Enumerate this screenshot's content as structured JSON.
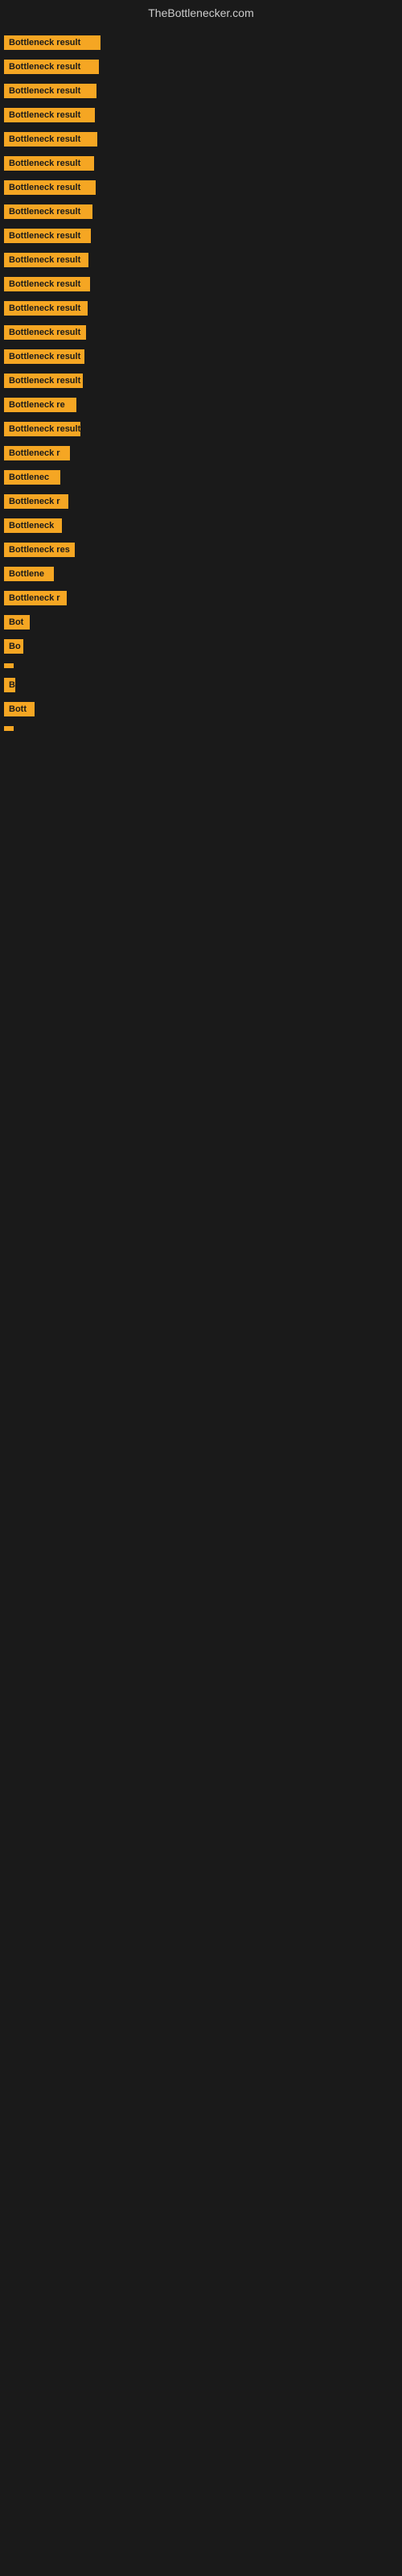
{
  "header": {
    "title": "TheBottlenecker.com"
  },
  "bars": [
    {
      "label": "Bottleneck result",
      "width": 120,
      "marginLeft": 5
    },
    {
      "label": "Bottleneck result",
      "width": 118,
      "marginLeft": 5
    },
    {
      "label": "Bottleneck result",
      "width": 115,
      "marginLeft": 5
    },
    {
      "label": "Bottleneck result",
      "width": 113,
      "marginLeft": 5
    },
    {
      "label": "Bottleneck result",
      "width": 116,
      "marginLeft": 5
    },
    {
      "label": "Bottleneck result",
      "width": 112,
      "marginLeft": 5
    },
    {
      "label": "Bottleneck result",
      "width": 114,
      "marginLeft": 5
    },
    {
      "label": "Bottleneck result",
      "width": 110,
      "marginLeft": 5
    },
    {
      "label": "Bottleneck result",
      "width": 108,
      "marginLeft": 5
    },
    {
      "label": "Bottleneck result",
      "width": 105,
      "marginLeft": 5
    },
    {
      "label": "Bottleneck result",
      "width": 107,
      "marginLeft": 5
    },
    {
      "label": "Bottleneck result",
      "width": 104,
      "marginLeft": 5
    },
    {
      "label": "Bottleneck result",
      "width": 102,
      "marginLeft": 5
    },
    {
      "label": "Bottleneck result",
      "width": 100,
      "marginLeft": 5
    },
    {
      "label": "Bottleneck result",
      "width": 98,
      "marginLeft": 5
    },
    {
      "label": "Bottleneck re",
      "width": 90,
      "marginLeft": 5
    },
    {
      "label": "Bottleneck result",
      "width": 95,
      "marginLeft": 5
    },
    {
      "label": "Bottleneck r",
      "width": 82,
      "marginLeft": 5
    },
    {
      "label": "Bottlenec",
      "width": 70,
      "marginLeft": 5
    },
    {
      "label": "Bottleneck r",
      "width": 80,
      "marginLeft": 5
    },
    {
      "label": "Bottleneck",
      "width": 72,
      "marginLeft": 5
    },
    {
      "label": "Bottleneck res",
      "width": 88,
      "marginLeft": 5
    },
    {
      "label": "Bottlene",
      "width": 62,
      "marginLeft": 5
    },
    {
      "label": "Bottleneck r",
      "width": 78,
      "marginLeft": 5
    },
    {
      "label": "Bot",
      "width": 32,
      "marginLeft": 5
    },
    {
      "label": "Bo",
      "width": 24,
      "marginLeft": 5
    },
    {
      "label": "",
      "width": 6,
      "marginLeft": 5
    },
    {
      "label": "B",
      "width": 14,
      "marginLeft": 5
    },
    {
      "label": "Bott",
      "width": 38,
      "marginLeft": 5
    },
    {
      "label": "",
      "width": 4,
      "marginLeft": 5
    }
  ]
}
